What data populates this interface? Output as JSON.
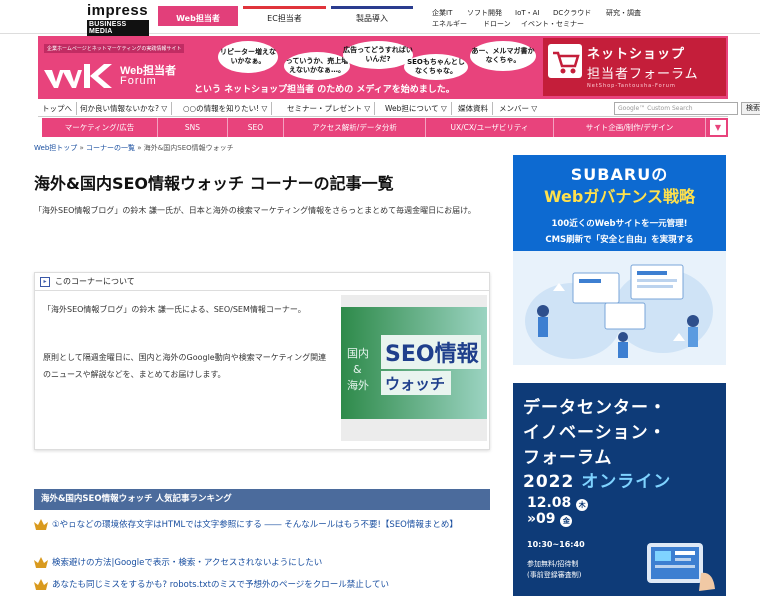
{
  "topbar": {
    "logo_line1": "impress",
    "logo_line2": "BUSINESS MEDIA",
    "tabs": [
      {
        "label": "Web担当者"
      },
      {
        "label": "EC担当者"
      },
      {
        "label": "製品導入"
      }
    ],
    "links_row1": [
      "企業IT",
      "ソフト開発",
      "IoT・AI",
      "DCクラウド",
      "研究・調査"
    ],
    "links_row2": [
      "エネルギー",
      "ドローン",
      "イベント・セミナー"
    ]
  },
  "banner": {
    "tagline": "企業ホームページとネットマーケティングの実践情報サイト",
    "logo_line1": "Web担当者",
    "logo_line2": "Forum",
    "bubbles": [
      "リピーター増えないかなぁ。",
      "っていうか、売上増えないかなぁ…。",
      "広告ってどうすればいいんだ?",
      "SEOもちゃんとしなくちゃな。",
      "あー、メルマガ書かなくちゃ。"
    ],
    "ad_copy": "という ネットショップ担当者 のための メディアを始めました。",
    "shop_title": "ネットショップ",
    "shop_subtitle": "担当者フォーラム",
    "shop_en": "NetShop-Tantousha-Forum"
  },
  "global_nav": {
    "items": [
      "トップへ",
      "何か良い情報ないかな? ▽",
      "○○の情報を知りたい! ▽",
      "セミナー・プレゼント ▽",
      "Web担について ▽",
      "媒体資料",
      "メンバー ▽"
    ],
    "search_placeholder": "Google™ Custom Search",
    "search_button": "検索"
  },
  "pink_nav": {
    "items": [
      "マーケティング/広告",
      "SNS",
      "SEO",
      "アクセス解析/データ分析",
      "UX/CX/ユーザビリティ",
      "サイト企画/制作/デザイン"
    ],
    "more": "▼"
  },
  "breadcrumb": {
    "home": "Web担トップ",
    "sep1": "»",
    "list": "コーナーの一覧",
    "sep2": "»",
    "current": "海外&国内SEO情報ウォッチ"
  },
  "page": {
    "title": "海外&国内SEO情報ウォッチ コーナーの記事一覧",
    "intro": "「海外SEO情報ブログ」の鈴木 謙一氏が、日本と海外の検索マーケティング情報をさらっとまとめて毎週金曜日にお届け。"
  },
  "corner_box": {
    "header": "このコーナーについて",
    "para1": "「海外SEO情報ブログ」の鈴木 謙一氏による、SEO/SEM情報コーナー。",
    "para2": "原則として隔週金曜日に、国内と海外のGoogle動向や検索マーケティング関連のニュースや解説などを、まとめてお届けします。",
    "img_text_main": "SEO情報",
    "img_text_sub": "ウォッチ",
    "img_text_side1": "国内",
    "img_text_side2": "&",
    "img_text_side3": "海外"
  },
  "ranking": {
    "header": "海外&国内SEO情報ウォッチ 人気記事ランキング",
    "items": [
      "①やㇿなどの環境依存文字はHTMLでは文字参照にする ―― そんなルールはもう不要!【SEO情報まとめ】",
      "検索避けの方法|Googleで表示・検索・アクセスされないようにしたい",
      "あなたも同じミスをするかも? robots.txtのミスで予想外のページをクロール禁止してい"
    ]
  },
  "ad_subaru": {
    "line1": "SUBARUの",
    "line2": "Webガバナンス戦略",
    "line3": "100近くのWebサイトを一元管理!",
    "line4": "CMS刷新で「安全と自由」を実現する"
  },
  "ad_dc": {
    "line1": "データセンター・",
    "line2": "イノベーション・",
    "line3": "フォーラム",
    "year": "2022",
    "online": "オンライン",
    "date1": "12.08",
    "dow1": "木",
    "date2": "»09",
    "dow2": "金",
    "time": "10:30~16:40",
    "fee1": "参加無料/招待制",
    "fee2": "(事前登録審査制)"
  },
  "colors": {
    "brand_pink": "#e8437c",
    "ranking_header": "#4b6b9c",
    "link_blue": "#1a4fa0",
    "shop_red": "#c41e3a"
  }
}
